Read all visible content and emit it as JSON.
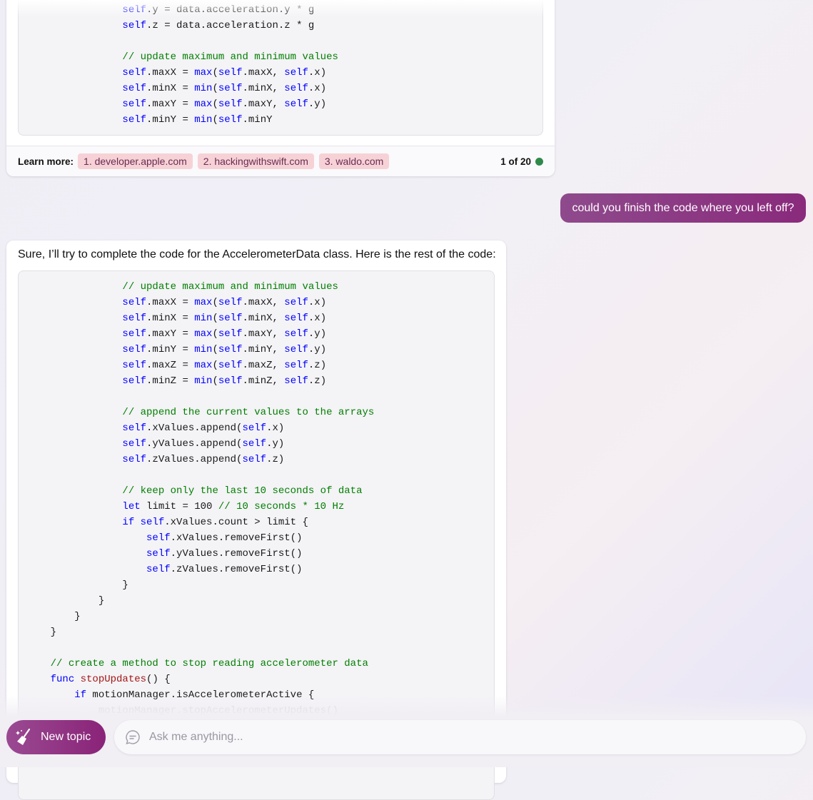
{
  "colors": {
    "keyword": "#0000ff",
    "comment": "#008000",
    "title": "#a31515",
    "chip_bg": "#f6d2d6",
    "accent": "#8a2a7c",
    "status_dot": "#2f8a4a"
  },
  "message1": {
    "code_lines": [
      [
        [
          "pl",
          "                "
        ],
        [
          "kw",
          "self"
        ],
        [
          "pl",
          ".y = data.acceleration.y * g"
        ]
      ],
      [
        [
          "pl",
          "                "
        ],
        [
          "kw",
          "self"
        ],
        [
          "pl",
          ".z = data.acceleration.z * g"
        ]
      ],
      [],
      [
        [
          "pl",
          "                "
        ],
        [
          "cm",
          "// update maximum and minimum values"
        ]
      ],
      [
        [
          "pl",
          "                "
        ],
        [
          "kw",
          "self"
        ],
        [
          "pl",
          ".maxX = "
        ],
        [
          "fn",
          "max"
        ],
        [
          "pl",
          "("
        ],
        [
          "kw",
          "self"
        ],
        [
          "pl",
          ".maxX, "
        ],
        [
          "kw",
          "self"
        ],
        [
          "pl",
          ".x)"
        ]
      ],
      [
        [
          "pl",
          "                "
        ],
        [
          "kw",
          "self"
        ],
        [
          "pl",
          ".minX = "
        ],
        [
          "fn",
          "min"
        ],
        [
          "pl",
          "("
        ],
        [
          "kw",
          "self"
        ],
        [
          "pl",
          ".minX, "
        ],
        [
          "kw",
          "self"
        ],
        [
          "pl",
          ".x)"
        ]
      ],
      [
        [
          "pl",
          "                "
        ],
        [
          "kw",
          "self"
        ],
        [
          "pl",
          ".maxY = "
        ],
        [
          "fn",
          "max"
        ],
        [
          "pl",
          "("
        ],
        [
          "kw",
          "self"
        ],
        [
          "pl",
          ".maxY, "
        ],
        [
          "kw",
          "self"
        ],
        [
          "pl",
          ".y)"
        ]
      ],
      [
        [
          "pl",
          "                "
        ],
        [
          "kw",
          "self"
        ],
        [
          "pl",
          ".minY = "
        ],
        [
          "fn",
          "min"
        ],
        [
          "pl",
          "("
        ],
        [
          "kw",
          "self"
        ],
        [
          "pl",
          ".minY"
        ]
      ]
    ],
    "learn_more_label": "Learn more:",
    "sources": [
      "1. developer.apple.com",
      "2. hackingwithswift.com",
      "3. waldo.com"
    ],
    "pager": "1 of 20"
  },
  "user_message": "could you finish the code where you left off?",
  "message2": {
    "intro": "Sure, I’ll try to complete the code for the AccelerometerData class. Here is the rest of the code:",
    "code_lines": [
      [
        [
          "pl",
          "                "
        ],
        [
          "cm",
          "// update maximum and minimum values"
        ]
      ],
      [
        [
          "pl",
          "                "
        ],
        [
          "kw",
          "self"
        ],
        [
          "pl",
          ".maxX = "
        ],
        [
          "fn",
          "max"
        ],
        [
          "pl",
          "("
        ],
        [
          "kw",
          "self"
        ],
        [
          "pl",
          ".maxX, "
        ],
        [
          "kw",
          "self"
        ],
        [
          "pl",
          ".x)"
        ]
      ],
      [
        [
          "pl",
          "                "
        ],
        [
          "kw",
          "self"
        ],
        [
          "pl",
          ".minX = "
        ],
        [
          "fn",
          "min"
        ],
        [
          "pl",
          "("
        ],
        [
          "kw",
          "self"
        ],
        [
          "pl",
          ".minX, "
        ],
        [
          "kw",
          "self"
        ],
        [
          "pl",
          ".x)"
        ]
      ],
      [
        [
          "pl",
          "                "
        ],
        [
          "kw",
          "self"
        ],
        [
          "pl",
          ".maxY = "
        ],
        [
          "fn",
          "max"
        ],
        [
          "pl",
          "("
        ],
        [
          "kw",
          "self"
        ],
        [
          "pl",
          ".maxY, "
        ],
        [
          "kw",
          "self"
        ],
        [
          "pl",
          ".y)"
        ]
      ],
      [
        [
          "pl",
          "                "
        ],
        [
          "kw",
          "self"
        ],
        [
          "pl",
          ".minY = "
        ],
        [
          "fn",
          "min"
        ],
        [
          "pl",
          "("
        ],
        [
          "kw",
          "self"
        ],
        [
          "pl",
          ".minY, "
        ],
        [
          "kw",
          "self"
        ],
        [
          "pl",
          ".y)"
        ]
      ],
      [
        [
          "pl",
          "                "
        ],
        [
          "kw",
          "self"
        ],
        [
          "pl",
          ".maxZ = "
        ],
        [
          "fn",
          "max"
        ],
        [
          "pl",
          "("
        ],
        [
          "kw",
          "self"
        ],
        [
          "pl",
          ".maxZ, "
        ],
        [
          "kw",
          "self"
        ],
        [
          "pl",
          ".z)"
        ]
      ],
      [
        [
          "pl",
          "                "
        ],
        [
          "kw",
          "self"
        ],
        [
          "pl",
          ".minZ = "
        ],
        [
          "fn",
          "min"
        ],
        [
          "pl",
          "("
        ],
        [
          "kw",
          "self"
        ],
        [
          "pl",
          ".minZ, "
        ],
        [
          "kw",
          "self"
        ],
        [
          "pl",
          ".z)"
        ]
      ],
      [],
      [
        [
          "pl",
          "                "
        ],
        [
          "cm",
          "// append the current values to the arrays"
        ]
      ],
      [
        [
          "pl",
          "                "
        ],
        [
          "kw",
          "self"
        ],
        [
          "pl",
          ".xValues.append("
        ],
        [
          "kw",
          "self"
        ],
        [
          "pl",
          ".x)"
        ]
      ],
      [
        [
          "pl",
          "                "
        ],
        [
          "kw",
          "self"
        ],
        [
          "pl",
          ".yValues.append("
        ],
        [
          "kw",
          "self"
        ],
        [
          "pl",
          ".y)"
        ]
      ],
      [
        [
          "pl",
          "                "
        ],
        [
          "kw",
          "self"
        ],
        [
          "pl",
          ".zValues.append("
        ],
        [
          "kw",
          "self"
        ],
        [
          "pl",
          ".z)"
        ]
      ],
      [],
      [
        [
          "pl",
          "                "
        ],
        [
          "cm",
          "// keep only the last 10 seconds of data"
        ]
      ],
      [
        [
          "pl",
          "                "
        ],
        [
          "kw",
          "let"
        ],
        [
          "pl",
          " limit = 100 "
        ],
        [
          "cm",
          "// 10 seconds * 10 Hz"
        ]
      ],
      [
        [
          "pl",
          "                "
        ],
        [
          "kw",
          "if"
        ],
        [
          "pl",
          " "
        ],
        [
          "kw",
          "self"
        ],
        [
          "pl",
          ".xValues.count > limit {"
        ]
      ],
      [
        [
          "pl",
          "                    "
        ],
        [
          "kw",
          "self"
        ],
        [
          "pl",
          ".xValues.removeFirst()"
        ]
      ],
      [
        [
          "pl",
          "                    "
        ],
        [
          "kw",
          "self"
        ],
        [
          "pl",
          ".yValues.removeFirst()"
        ]
      ],
      [
        [
          "pl",
          "                    "
        ],
        [
          "kw",
          "self"
        ],
        [
          "pl",
          ".zValues.removeFirst()"
        ]
      ],
      [
        [
          "pl",
          "                }"
        ]
      ],
      [
        [
          "pl",
          "            }"
        ]
      ],
      [
        [
          "pl",
          "        }"
        ]
      ],
      [
        [
          "pl",
          "    }"
        ]
      ],
      [],
      [
        [
          "pl",
          "    "
        ],
        [
          "cm",
          "// create a method to stop reading accelerometer data"
        ]
      ],
      [
        [
          "pl",
          "    "
        ],
        [
          "kw",
          "func"
        ],
        [
          "pl",
          " "
        ],
        [
          "ti",
          "stopUpdates"
        ],
        [
          "pl",
          "() {"
        ]
      ],
      [
        [
          "pl",
          "        "
        ],
        [
          "kw",
          "if"
        ],
        [
          "pl",
          " motionManager.isAccelerometerActive {"
        ]
      ],
      [
        [
          "pl",
          "            motionManager.stopAccelerometerUpdates()"
        ]
      ]
    ]
  },
  "composer": {
    "new_topic": "New topic",
    "placeholder": "Ask me anything..."
  }
}
